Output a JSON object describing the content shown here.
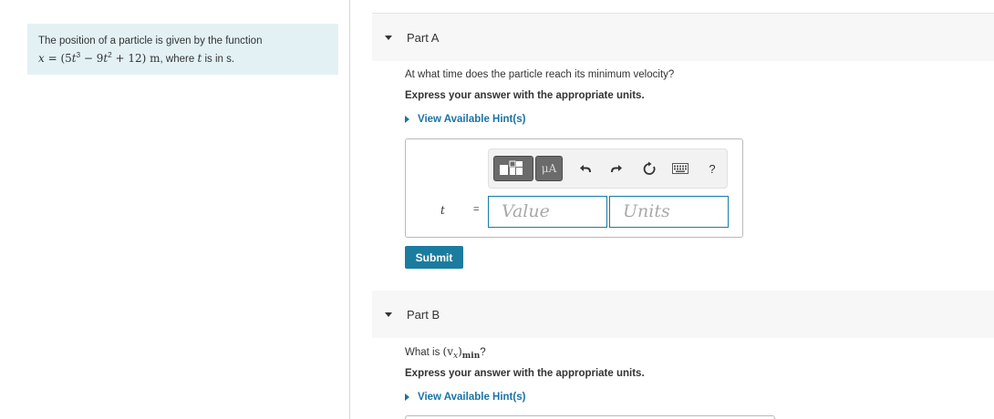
{
  "intro": {
    "text_prefix": "The position of a particle is given by the function",
    "formula_var": "x",
    "formula_eq": " = (5",
    "formula_t1": "t",
    "formula_exp1": "3",
    "formula_mid1": " − 9",
    "formula_t2": "t",
    "formula_exp2": "2",
    "formula_mid2": " + 12) ",
    "formula_unit": "m",
    "formula_after": ", where ",
    "where_var": "t",
    "where_after": " is in s."
  },
  "partA": {
    "title": "Part A",
    "question": "At what time does the particle reach its minimum velocity?",
    "instruction": "Express your answer with the appropriate units.",
    "hint": "View Available Hint(s)",
    "variable": "t",
    "equals": "=",
    "value_placeholder": "Value",
    "units_placeholder": "Units",
    "submit": "Submit"
  },
  "toolbar": {
    "templates_icon": "templates-icon",
    "units_label": "μA",
    "undo_icon": "↶",
    "redo_icon": "↷",
    "reset_icon": "↻",
    "keyboard_icon": "keyboard-icon",
    "help_label": "?"
  },
  "partB": {
    "title": "Part B",
    "question_prefix": "What is ",
    "question_var_open": "(v",
    "question_sub_x": "x",
    "question_var_close": ")",
    "question_sub_min": "min",
    "question_suffix": "?",
    "instruction": "Express your answer with the appropriate units.",
    "hint": "View Available Hint(s)"
  },
  "colors": {
    "intro_bg": "#e3f1f5",
    "link": "#1a73a6",
    "submit_bg": "#1b7c9f",
    "input_border": "#1a7aa8"
  }
}
